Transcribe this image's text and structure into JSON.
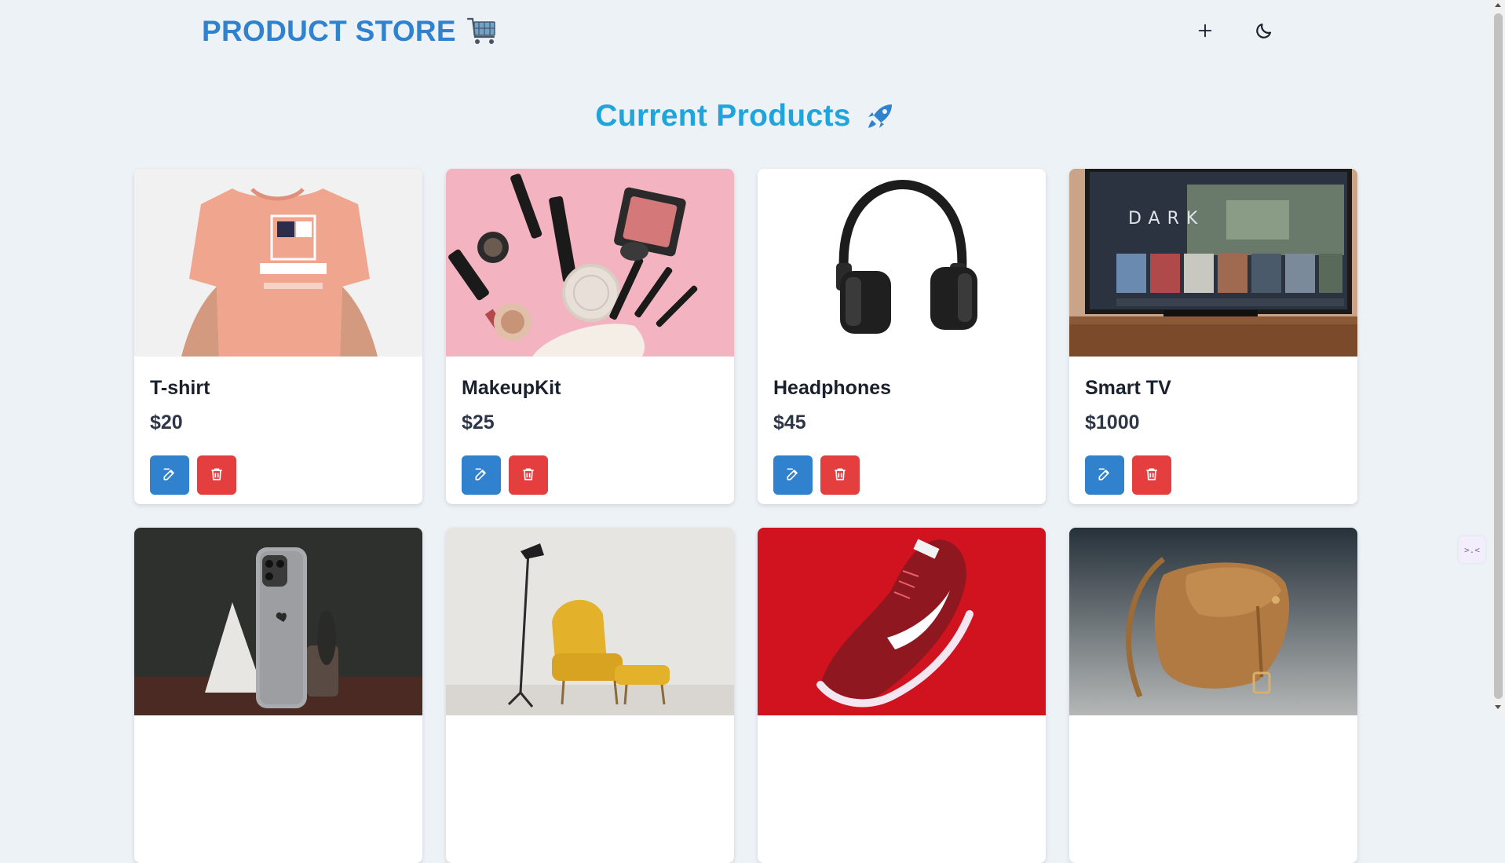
{
  "navbar": {
    "brand": "PRODUCT STORE",
    "brand_icon": "shopping-cart-icon",
    "create_icon": "plus-icon",
    "theme_icon": "moon-icon"
  },
  "section": {
    "title": "Current Products",
    "icon": "rocket-icon"
  },
  "colors": {
    "brand": "#3182ce",
    "title": "#1fa5dc",
    "edit_button": "#3182ce",
    "delete_button": "#e53e3e",
    "background": "#edf2f7"
  },
  "products": [
    {
      "name": "T-shirt",
      "price": "$20",
      "image": "t-shirt-photo"
    },
    {
      "name": "MakeupKit",
      "price": "$25",
      "image": "makeup-kit-photo"
    },
    {
      "name": "Headphones",
      "price": "$45",
      "image": "headphones-photo"
    },
    {
      "name": "Smart TV",
      "price": "$1000",
      "image": "smart-tv-photo"
    },
    {
      "image": "smartphone-photo"
    },
    {
      "image": "armchair-photo"
    },
    {
      "image": "sneaker-photo"
    },
    {
      "image": "leather-bag-photo"
    }
  ],
  "extension_widget": ">.<"
}
